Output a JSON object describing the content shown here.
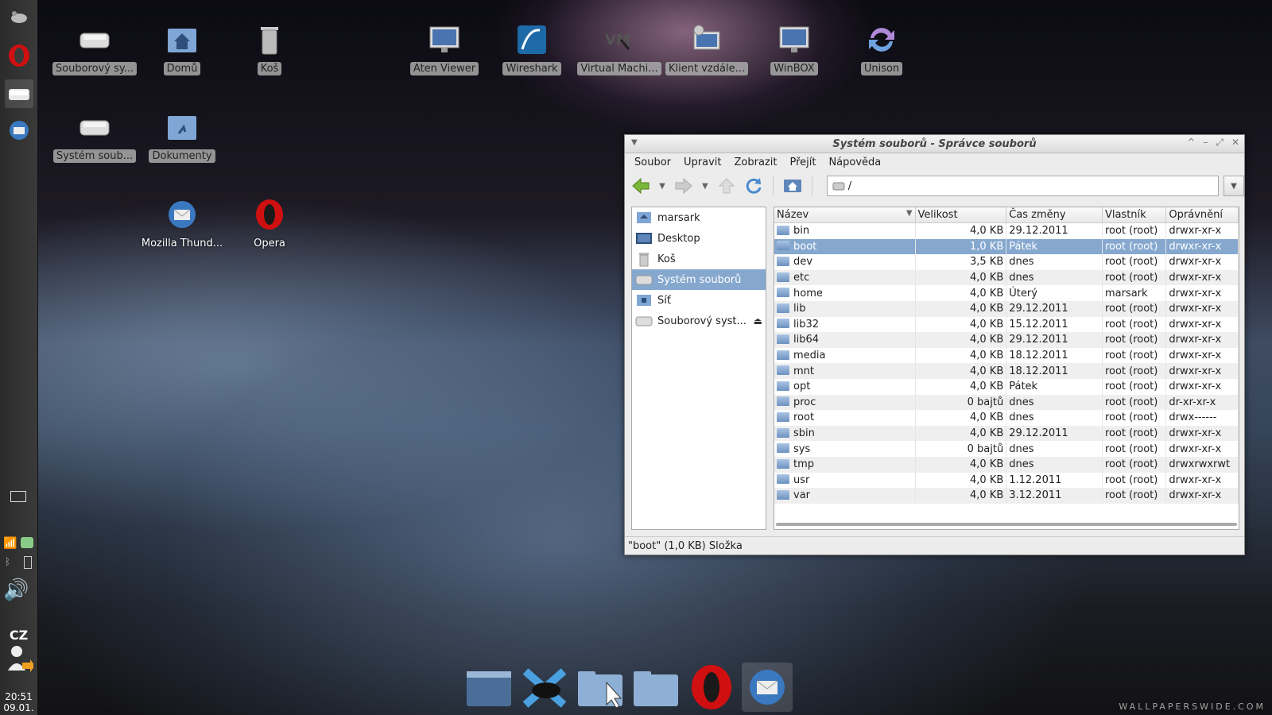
{
  "desktop": {
    "icons": [
      {
        "label": "Souborový sy..."
      },
      {
        "label": "Domů"
      },
      {
        "label": "Koš"
      },
      {
        "label": "Aten Viewer"
      },
      {
        "label": "Wireshark"
      },
      {
        "label": "Virtual Machi..."
      },
      {
        "label": "Klient vzdále..."
      },
      {
        "label": "WinBOX"
      },
      {
        "label": "Unison"
      },
      {
        "label": "Systém soub..."
      },
      {
        "label": "Dokumenty"
      },
      {
        "label": "Mozilla Thund..."
      },
      {
        "label": "Opera"
      }
    ]
  },
  "panel": {
    "keyboard_layout": "CZ",
    "time": "20:51",
    "date": "09.01."
  },
  "window": {
    "title": "Systém souborů - Správce souborů",
    "menu": [
      "Soubor",
      "Upravit",
      "Zobrazit",
      "Přejít",
      "Nápověda"
    ],
    "location": "/",
    "sidebar": [
      {
        "label": "marsark"
      },
      {
        "label": "Desktop"
      },
      {
        "label": "Koš"
      },
      {
        "label": "Systém souborů"
      },
      {
        "label": "Síť"
      },
      {
        "label": "Souborový syst..."
      }
    ],
    "columns": [
      "Název",
      "Velikost",
      "Čas změny",
      "Vlastník",
      "Oprávnění"
    ],
    "files": [
      [
        "bin",
        "4,0 KB",
        "29.12.2011",
        "root (root)",
        "drwxr-xr-x"
      ],
      [
        "boot",
        "1,0 KB",
        "Pátek",
        "root (root)",
        "drwxr-xr-x"
      ],
      [
        "dev",
        "3,5 KB",
        "dnes",
        "root (root)",
        "drwxr-xr-x"
      ],
      [
        "etc",
        "4,0 KB",
        "dnes",
        "root (root)",
        "drwxr-xr-x"
      ],
      [
        "home",
        "4,0 KB",
        "Úterý",
        "marsark",
        "drwxr-xr-x"
      ],
      [
        "lib",
        "4,0 KB",
        "29.12.2011",
        "root (root)",
        "drwxr-xr-x"
      ],
      [
        "lib32",
        "4,0 KB",
        "15.12.2011",
        "root (root)",
        "drwxr-xr-x"
      ],
      [
        "lib64",
        "4,0 KB",
        "29.12.2011",
        "root (root)",
        "drwxr-xr-x"
      ],
      [
        "media",
        "4,0 KB",
        "18.12.2011",
        "root (root)",
        "drwxr-xr-x"
      ],
      [
        "mnt",
        "4,0 KB",
        "18.12.2011",
        "root (root)",
        "drwxr-xr-x"
      ],
      [
        "opt",
        "4,0 KB",
        "Pátek",
        "root (root)",
        "drwxr-xr-x"
      ],
      [
        "proc",
        "0 bajtů",
        "dnes",
        "root (root)",
        "dr-xr-xr-x"
      ],
      [
        "root",
        "4,0 KB",
        "dnes",
        "root (root)",
        "drwx------"
      ],
      [
        "sbin",
        "4,0 KB",
        "29.12.2011",
        "root (root)",
        "drwxr-xr-x"
      ],
      [
        "sys",
        "0 bajtů",
        "dnes",
        "root (root)",
        "drwxr-xr-x"
      ],
      [
        "tmp",
        "4,0 KB",
        "dnes",
        "root (root)",
        "drwxrwxrwt"
      ],
      [
        "usr",
        "4,0 KB",
        "1.12.2011",
        "root (root)",
        "drwxr-xr-x"
      ],
      [
        "var",
        "4,0 KB",
        "3.12.2011",
        "root (root)",
        "drwxr-xr-x"
      ]
    ],
    "selected_row": 1,
    "status": "\"boot\" (1,0 KB) Složka"
  },
  "watermark": "WALLPAPERSWIDE.COM"
}
